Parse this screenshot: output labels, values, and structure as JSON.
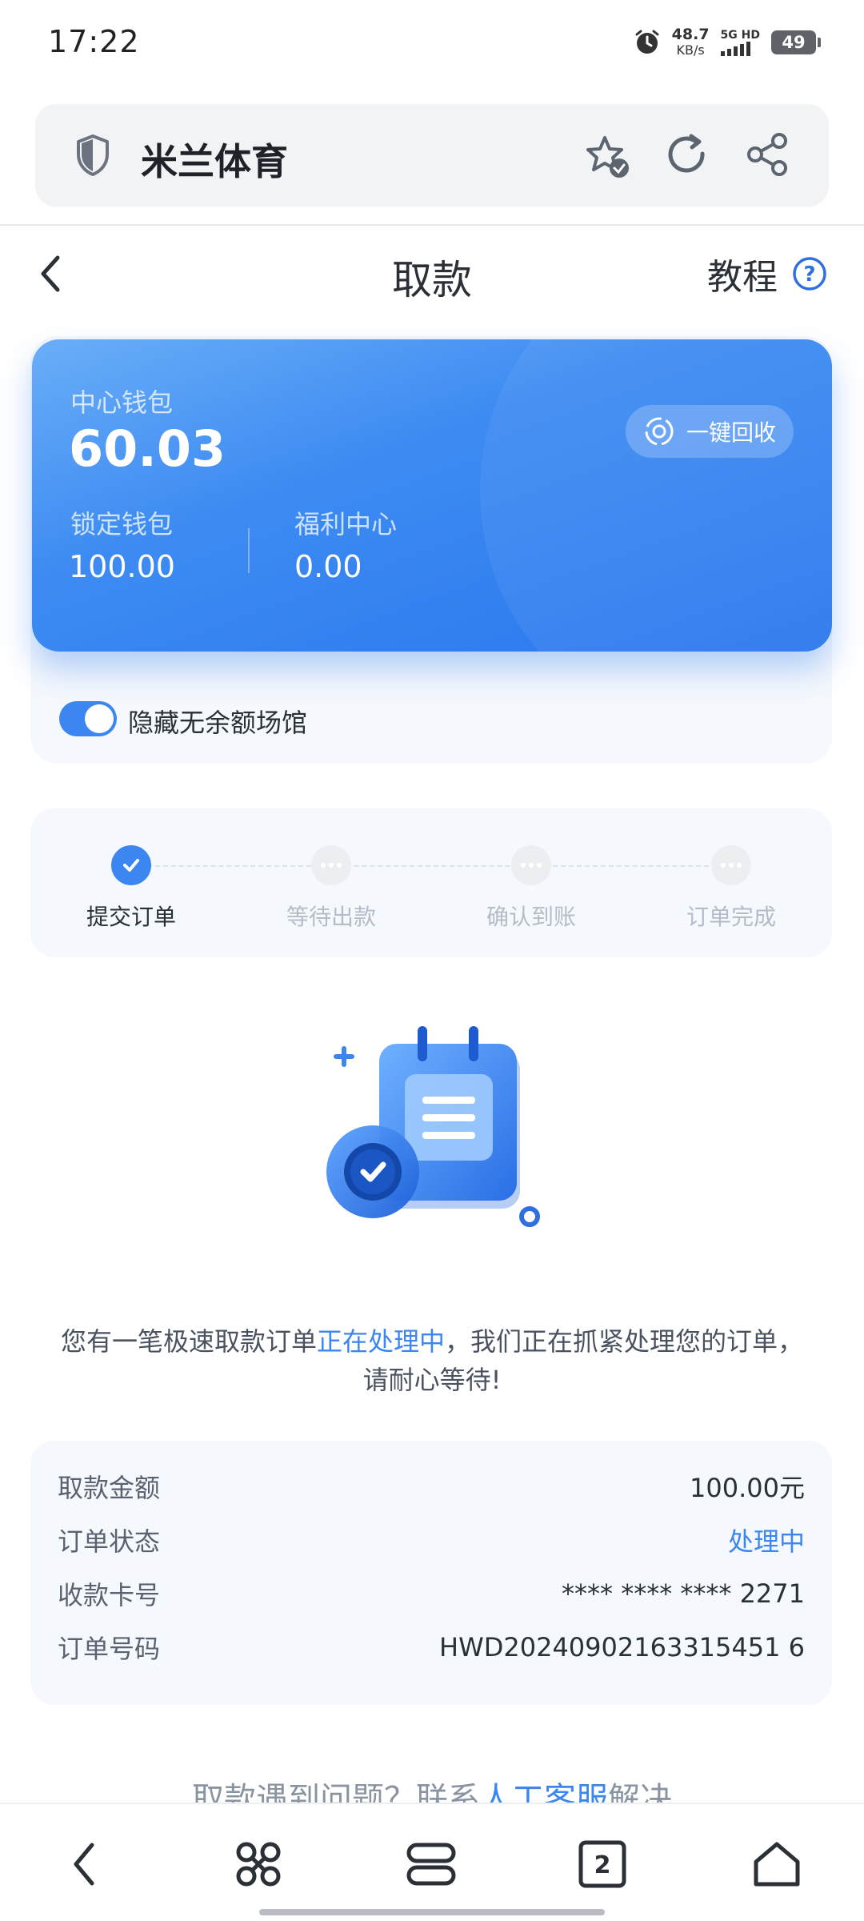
{
  "status_bar": {
    "time": "17:22",
    "net_speed_value": "48.7",
    "net_speed_unit": "KB/s",
    "signal_label": "5G HD",
    "battery": "49",
    "icons": [
      "alarm-icon",
      "signal-icon",
      "battery-icon"
    ]
  },
  "address_bar": {
    "site_title": "米兰体育",
    "icons": [
      "shield-icon",
      "favorite-star-icon",
      "reload-icon",
      "share-icon"
    ]
  },
  "header": {
    "title": "取款",
    "tutorial_label": "教程",
    "help_glyph": "?"
  },
  "wallet": {
    "main_label": "中心钱包",
    "main_value": "60.03",
    "recycle_label": "一键回收",
    "locked_label": "锁定钱包",
    "locked_value": "100.00",
    "benefit_label": "福利中心",
    "benefit_value": "0.00",
    "hide_empty_label": "隐藏无余额场馆",
    "hide_empty_on": true
  },
  "steps": [
    {
      "label": "提交订单",
      "state": "done"
    },
    {
      "label": "等待出款",
      "state": "pending"
    },
    {
      "label": "确认到账",
      "state": "pending"
    },
    {
      "label": "订单完成",
      "state": "pending"
    }
  ],
  "message": {
    "prefix": "您有一笔极速取款订单",
    "highlight": "正在处理中",
    "suffix": "，我们正在抓紧处理您的订单，",
    "line2": "请耐心等待!"
  },
  "details": [
    {
      "label": "取款金额",
      "value": "100.00元"
    },
    {
      "label": "订单状态",
      "value": "处理中"
    },
    {
      "label": "收款卡号",
      "value": "**** **** **** 2271"
    },
    {
      "label": "订单号码",
      "value": "HWD20240902163315451 6"
    }
  ],
  "contact": {
    "prefix": "取款遇到问题？联系",
    "link": "人工客服",
    "suffix": "解决"
  },
  "bottom_nav": {
    "tab_count": "2",
    "icons": [
      "back-icon",
      "apps-icon",
      "menu-icon",
      "tabs-icon",
      "home-icon"
    ]
  },
  "colors": {
    "accent": "#3b86f0",
    "card_gradient_start": "#6aaef8",
    "card_gradient_end": "#2a77ef",
    "panel_bg": "#f5f8fc"
  }
}
